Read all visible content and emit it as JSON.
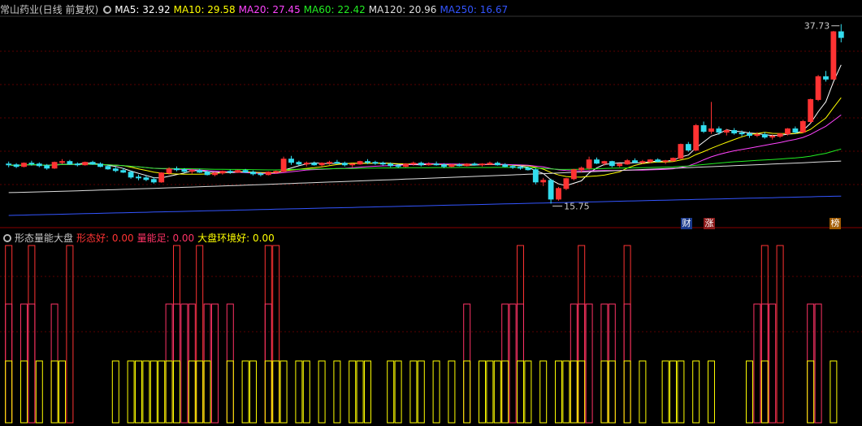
{
  "main": {
    "title": "常山药业(日线 前复权)",
    "ma": [
      {
        "label": "MA5: 32.92",
        "color": "#ffffff"
      },
      {
        "label": "MA10: 29.58",
        "color": "#ffff00"
      },
      {
        "label": "MA20: 27.45",
        "color": "#ff44ff"
      },
      {
        "label": "MA60: 22.42",
        "color": "#22ee22"
      },
      {
        "label": "MA120: 20.96",
        "color": "#dddddd"
      },
      {
        "label": "MA250: 16.67",
        "color": "#3355ff"
      }
    ],
    "high_label": "37.73",
    "low_label": "15.75",
    "tags": [
      {
        "text": "财",
        "bg": "#1a3a8c",
        "fg": "#ffffff"
      },
      {
        "text": "涨",
        "bg": "#8c1a1a",
        "fg": "#ffffff"
      },
      {
        "text": "榜",
        "bg": "#a05a00",
        "fg": "#ffffff"
      }
    ]
  },
  "indicator": {
    "title": "形态量能大盘",
    "items": [
      {
        "label": "形态好: 0.00",
        "color": "#ff3333"
      },
      {
        "label": "量能足: 0.00",
        "color": "#ff3366"
      },
      {
        "label": "大盘环境好: 0.00",
        "color": "#ffff00"
      }
    ]
  },
  "chart_data": {
    "type": "candlestick",
    "y_range": [
      14.0,
      38.5
    ],
    "candles": [
      [
        20.6,
        20.9,
        20.2,
        20.5
      ],
      [
        20.5,
        20.7,
        20.1,
        20.3
      ],
      [
        20.3,
        20.8,
        20.2,
        20.7
      ],
      [
        20.7,
        21.0,
        20.4,
        20.6
      ],
      [
        20.6,
        20.8,
        20.2,
        20.4
      ],
      [
        20.4,
        20.6,
        19.9,
        20.1
      ],
      [
        20.1,
        20.9,
        20.0,
        20.8
      ],
      [
        20.8,
        21.2,
        20.6,
        20.9
      ],
      [
        20.9,
        21.1,
        20.5,
        20.6
      ],
      [
        20.6,
        20.8,
        20.3,
        20.5
      ],
      [
        20.5,
        20.9,
        20.4,
        20.8
      ],
      [
        20.8,
        21.0,
        20.5,
        20.6
      ],
      [
        20.6,
        20.8,
        20.2,
        20.3
      ],
      [
        20.3,
        20.5,
        19.9,
        20.0
      ],
      [
        20.0,
        20.3,
        19.6,
        19.8
      ],
      [
        19.8,
        20.1,
        19.5,
        19.6
      ],
      [
        19.6,
        19.8,
        18.8,
        19.0
      ],
      [
        19.0,
        19.3,
        18.6,
        18.9
      ],
      [
        18.9,
        19.2,
        18.5,
        18.7
      ],
      [
        18.7,
        19.0,
        18.2,
        18.4
      ],
      [
        18.4,
        19.6,
        18.3,
        19.5
      ],
      [
        19.5,
        20.2,
        19.3,
        20.0
      ],
      [
        20.0,
        20.3,
        19.7,
        19.9
      ],
      [
        19.9,
        20.1,
        19.5,
        19.7
      ],
      [
        19.7,
        20.0,
        19.4,
        19.8
      ],
      [
        19.8,
        20.0,
        19.5,
        19.6
      ],
      [
        19.6,
        19.8,
        19.2,
        19.3
      ],
      [
        19.3,
        19.6,
        19.1,
        19.5
      ],
      [
        19.5,
        19.8,
        19.3,
        19.7
      ],
      [
        19.7,
        19.9,
        19.4,
        19.6
      ],
      [
        19.6,
        19.9,
        19.5,
        19.8
      ],
      [
        19.8,
        20.0,
        19.5,
        19.6
      ],
      [
        19.6,
        19.8,
        19.2,
        19.4
      ],
      [
        19.4,
        19.6,
        19.1,
        19.3
      ],
      [
        19.3,
        19.7,
        19.2,
        19.6
      ],
      [
        19.6,
        19.8,
        19.4,
        19.7
      ],
      [
        19.7,
        21.5,
        19.6,
        21.2
      ],
      [
        21.2,
        21.6,
        20.5,
        20.8
      ],
      [
        20.8,
        21.0,
        20.4,
        20.6
      ],
      [
        20.6,
        20.9,
        20.3,
        20.7
      ],
      [
        20.7,
        20.9,
        20.4,
        20.5
      ],
      [
        20.5,
        20.8,
        20.3,
        20.7
      ],
      [
        20.7,
        21.0,
        20.5,
        20.8
      ],
      [
        20.8,
        21.1,
        20.6,
        20.7
      ],
      [
        20.7,
        20.9,
        20.3,
        20.5
      ],
      [
        20.5,
        20.7,
        20.2,
        20.6
      ],
      [
        20.6,
        21.0,
        20.5,
        20.9
      ],
      [
        20.9,
        21.2,
        20.6,
        20.8
      ],
      [
        20.8,
        21.0,
        20.5,
        20.7
      ],
      [
        20.7,
        20.9,
        20.4,
        20.6
      ],
      [
        20.6,
        20.8,
        20.2,
        20.4
      ],
      [
        20.4,
        20.6,
        20.1,
        20.3
      ],
      [
        20.3,
        20.7,
        20.2,
        20.6
      ],
      [
        20.6,
        20.9,
        20.4,
        20.7
      ],
      [
        20.7,
        20.9,
        20.3,
        20.5
      ],
      [
        20.5,
        20.8,
        20.4,
        20.6
      ],
      [
        20.6,
        20.9,
        20.4,
        20.5
      ],
      [
        20.5,
        20.7,
        20.1,
        20.3
      ],
      [
        20.3,
        20.6,
        20.2,
        20.5
      ],
      [
        20.5,
        20.7,
        20.3,
        20.4
      ],
      [
        20.4,
        20.7,
        20.3,
        20.6
      ],
      [
        20.6,
        20.8,
        20.4,
        20.5
      ],
      [
        20.5,
        20.7,
        20.3,
        20.6
      ],
      [
        20.6,
        20.9,
        20.5,
        20.7
      ],
      [
        20.7,
        20.9,
        20.4,
        20.5
      ],
      [
        20.5,
        20.7,
        20.2,
        20.3
      ],
      [
        20.3,
        20.5,
        20.0,
        20.2
      ],
      [
        20.2,
        20.4,
        19.9,
        20.1
      ],
      [
        20.1,
        20.3,
        19.8,
        19.9
      ],
      [
        19.9,
        20.1,
        18.1,
        18.4
      ],
      [
        18.4,
        18.9,
        17.9,
        18.6
      ],
      [
        18.6,
        18.8,
        15.75,
        16.3
      ],
      [
        16.3,
        17.8,
        16.1,
        17.6
      ],
      [
        17.6,
        18.9,
        17.4,
        18.8
      ],
      [
        18.8,
        20.0,
        18.6,
        19.9
      ],
      [
        19.9,
        20.3,
        19.6,
        20.1
      ],
      [
        20.1,
        21.5,
        19.9,
        21.1
      ],
      [
        21.1,
        21.4,
        20.6,
        20.7
      ],
      [
        20.7,
        21.0,
        20.4,
        20.9
      ],
      [
        20.9,
        21.0,
        20.2,
        20.4
      ],
      [
        20.4,
        20.7,
        20.2,
        20.6
      ],
      [
        20.6,
        21.2,
        20.5,
        21.0
      ],
      [
        21.0,
        21.3,
        20.7,
        20.8
      ],
      [
        20.8,
        21.1,
        20.6,
        20.9
      ],
      [
        20.9,
        21.2,
        20.7,
        21.1
      ],
      [
        21.1,
        21.3,
        20.8,
        20.9
      ],
      [
        20.9,
        21.1,
        20.6,
        21.0
      ],
      [
        21.0,
        21.4,
        20.9,
        21.3
      ],
      [
        21.3,
        23.1,
        21.2,
        23.0
      ],
      [
        23.0,
        23.3,
        22.1,
        22.3
      ],
      [
        22.3,
        25.5,
        22.2,
        25.3
      ],
      [
        25.3,
        25.8,
        24.4,
        24.6
      ],
      [
        24.6,
        28.2,
        24.3,
        24.9
      ],
      [
        24.9,
        25.2,
        24.2,
        24.5
      ],
      [
        24.5,
        24.9,
        24.1,
        24.7
      ],
      [
        24.7,
        25.0,
        24.2,
        24.4
      ],
      [
        24.4,
        24.7,
        24.0,
        24.3
      ],
      [
        24.3,
        24.6,
        23.8,
        24.1
      ],
      [
        24.1,
        24.5,
        23.9,
        24.2
      ],
      [
        24.2,
        24.5,
        23.7,
        23.9
      ],
      [
        23.9,
        24.2,
        23.6,
        24.0
      ],
      [
        24.0,
        24.4,
        23.8,
        24.3
      ],
      [
        24.3,
        25.0,
        24.1,
        24.9
      ],
      [
        24.9,
        25.2,
        24.3,
        24.5
      ],
      [
        24.5,
        26.0,
        24.4,
        25.8
      ],
      [
        25.8,
        28.6,
        25.6,
        28.5
      ],
      [
        28.5,
        31.5,
        28.3,
        31.3
      ],
      [
        31.3,
        32.0,
        30.7,
        31.0
      ],
      [
        31.0,
        36.9,
        30.9,
        36.8
      ],
      [
        36.8,
        37.73,
        35.5,
        36.1
      ]
    ],
    "ma_series": [
      {
        "name": "MA5",
        "color": "#ffffff"
      },
      {
        "name": "MA10",
        "color": "#ffff00"
      },
      {
        "name": "MA20",
        "color": "#ff44ff"
      },
      {
        "name": "MA60",
        "color": "#22ee22"
      },
      {
        "name": "MA120",
        "color": "#dddddd",
        "start": 17.1,
        "end": 20.96
      },
      {
        "name": "MA250",
        "color": "#3355ff",
        "start": 14.3,
        "end": 16.67
      }
    ],
    "indicator_bars": {
      "形态好": [
        1,
        0,
        0,
        1,
        0,
        0,
        0,
        0,
        1,
        0,
        0,
        0,
        0,
        0,
        0,
        0,
        0,
        0,
        0,
        0,
        0,
        0,
        1,
        0,
        0,
        1,
        0,
        0,
        0,
        0,
        0,
        0,
        0,
        0,
        1,
        1,
        0,
        0,
        0,
        0,
        0,
        0,
        0,
        0,
        0,
        0,
        0,
        0,
        0,
        0,
        0,
        0,
        0,
        0,
        0,
        0,
        0,
        0,
        0,
        0,
        0,
        0,
        0,
        0,
        0,
        0,
        0,
        1,
        0,
        0,
        0,
        0,
        0,
        0,
        0,
        1,
        0,
        0,
        0,
        0,
        0,
        1,
        0,
        0,
        0,
        0,
        0,
        0,
        0,
        0,
        0,
        0,
        0,
        0,
        0,
        0,
        0,
        0,
        0,
        1,
        0,
        1,
        0,
        0,
        0,
        0,
        0,
        0,
        0,
        0,
        0
      ],
      "量能足": [
        1,
        0,
        1,
        1,
        0,
        0,
        1,
        0,
        0,
        0,
        0,
        0,
        0,
        0,
        0,
        0,
        0,
        0,
        0,
        0,
        0,
        1,
        1,
        1,
        1,
        0,
        1,
        1,
        0,
        1,
        0,
        0,
        0,
        0,
        1,
        0,
        0,
        0,
        0,
        0,
        0,
        0,
        0,
        0,
        0,
        0,
        0,
        0,
        0,
        0,
        0,
        0,
        0,
        0,
        0,
        0,
        0,
        0,
        0,
        0,
        1,
        0,
        0,
        0,
        0,
        1,
        1,
        1,
        0,
        0,
        0,
        0,
        0,
        0,
        1,
        1,
        1,
        0,
        1,
        1,
        0,
        1,
        0,
        0,
        0,
        0,
        0,
        0,
        0,
        0,
        0,
        0,
        0,
        0,
        0,
        0,
        0,
        0,
        1,
        1,
        1,
        0,
        0,
        0,
        0,
        1,
        1,
        0,
        0,
        0,
        0
      ],
      "大盘环境好": [
        1,
        0,
        1,
        0,
        1,
        0,
        1,
        1,
        0,
        0,
        0,
        0,
        0,
        0,
        1,
        0,
        1,
        1,
        1,
        1,
        1,
        1,
        1,
        0,
        1,
        1,
        1,
        0,
        0,
        1,
        0,
        1,
        1,
        0,
        1,
        1,
        1,
        0,
        1,
        1,
        0,
        1,
        0,
        1,
        0,
        1,
        1,
        1,
        0,
        0,
        1,
        1,
        0,
        1,
        1,
        0,
        1,
        0,
        1,
        0,
        1,
        0,
        1,
        1,
        1,
        1,
        0,
        1,
        1,
        0,
        1,
        0,
        1,
        1,
        1,
        1,
        0,
        0,
        1,
        1,
        0,
        1,
        0,
        1,
        0,
        0,
        1,
        1,
        1,
        0,
        1,
        0,
        1,
        0,
        0,
        0,
        0,
        1,
        0,
        1,
        0,
        0,
        0,
        0,
        0,
        1,
        0,
        0,
        1,
        0,
        0
      ]
    }
  }
}
